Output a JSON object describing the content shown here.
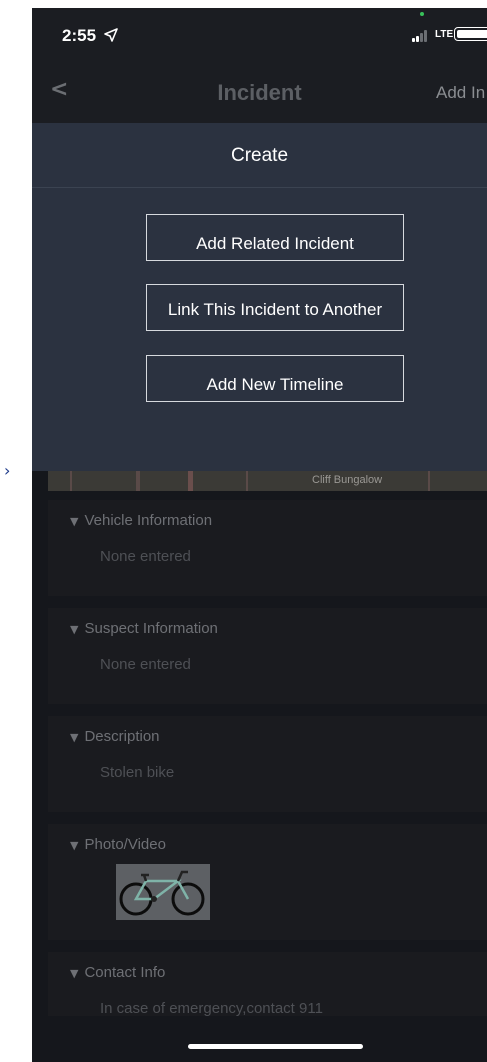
{
  "status_bar": {
    "time": "2:55",
    "network": "LTE",
    "colors": {
      "location_dot": "#38c15a"
    }
  },
  "nav": {
    "back_icon": "chevron-left-icon",
    "back_glyph": "<",
    "title": "Incident",
    "action": "Add In"
  },
  "sheet": {
    "title": "Create",
    "buttons": [
      {
        "label": "Add Related Incident"
      },
      {
        "label": "Link This Incident to Another"
      },
      {
        "label": "Add New Timeline"
      }
    ]
  },
  "map": {
    "label": "Cliff Bungalow"
  },
  "sections": [
    {
      "title": "Vehicle Information",
      "value": "None entered"
    },
    {
      "title": "Suspect Information",
      "value": "None entered"
    },
    {
      "title": "Description",
      "value": "Stolen bike"
    },
    {
      "title": "Photo/Video",
      "value": ""
    },
    {
      "title": "Contact Info",
      "value": "In case of emergency,contact 911"
    }
  ],
  "left_marker": "›",
  "icons": {
    "location_arrow": "location-arrow-icon",
    "expand": "triangle-down-icon",
    "photo": "bicycle-photo"
  },
  "colors": {
    "sheet_bg": "#2b3240",
    "app_bg": "#15171c",
    "card_bg": "#1a1b1f",
    "accent_marker": "#1d3a8a"
  }
}
